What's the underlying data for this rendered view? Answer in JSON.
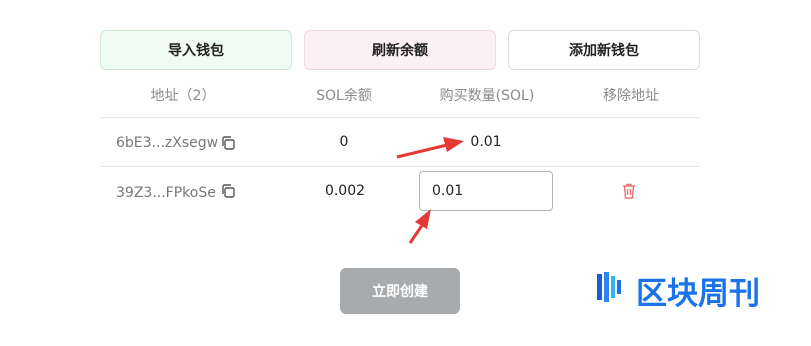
{
  "toolbar": {
    "import_label": "导入钱包",
    "refresh_label": "刷新余额",
    "add_label": "添加新钱包"
  },
  "table": {
    "headers": {
      "address": "地址（2）",
      "sol_balance": "SOL余额",
      "buy_amount": "购买数量(SOL)",
      "remove": "移除地址"
    },
    "rows": [
      {
        "address": "6bE3...zXsegw",
        "balance": "0",
        "buy_amount": "0.01"
      },
      {
        "address": "39Z3...FPkoSe",
        "balance": "0.002",
        "buy_amount": "0.01"
      }
    ]
  },
  "actions": {
    "create_label": "立即创建"
  },
  "watermark": {
    "text": "区块周刊"
  },
  "colors": {
    "import_bg": "#f0fbf3",
    "refresh_bg": "#fdf0f4",
    "create_bg": "#a8abae",
    "annotation_arrow": "#e53935",
    "trash": "#e57373",
    "watermark": "#1a73e8"
  }
}
